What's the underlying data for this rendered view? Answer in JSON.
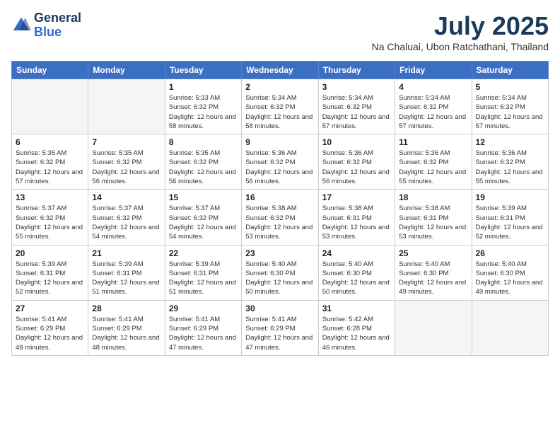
{
  "header": {
    "logo_general": "General",
    "logo_blue": "Blue",
    "month_year": "July 2025",
    "location": "Na Chaluai, Ubon Ratchathani, Thailand"
  },
  "days_of_week": [
    "Sunday",
    "Monday",
    "Tuesday",
    "Wednesday",
    "Thursday",
    "Friday",
    "Saturday"
  ],
  "weeks": [
    [
      {
        "day": "",
        "info": ""
      },
      {
        "day": "",
        "info": ""
      },
      {
        "day": "1",
        "info": "Sunrise: 5:33 AM\nSunset: 6:32 PM\nDaylight: 12 hours and 58 minutes."
      },
      {
        "day": "2",
        "info": "Sunrise: 5:34 AM\nSunset: 6:32 PM\nDaylight: 12 hours and 58 minutes."
      },
      {
        "day": "3",
        "info": "Sunrise: 5:34 AM\nSunset: 6:32 PM\nDaylight: 12 hours and 57 minutes."
      },
      {
        "day": "4",
        "info": "Sunrise: 5:34 AM\nSunset: 6:32 PM\nDaylight: 12 hours and 57 minutes."
      },
      {
        "day": "5",
        "info": "Sunrise: 5:34 AM\nSunset: 6:32 PM\nDaylight: 12 hours and 57 minutes."
      }
    ],
    [
      {
        "day": "6",
        "info": "Sunrise: 5:35 AM\nSunset: 6:32 PM\nDaylight: 12 hours and 57 minutes."
      },
      {
        "day": "7",
        "info": "Sunrise: 5:35 AM\nSunset: 6:32 PM\nDaylight: 12 hours and 56 minutes."
      },
      {
        "day": "8",
        "info": "Sunrise: 5:35 AM\nSunset: 6:32 PM\nDaylight: 12 hours and 56 minutes."
      },
      {
        "day": "9",
        "info": "Sunrise: 5:36 AM\nSunset: 6:32 PM\nDaylight: 12 hours and 56 minutes."
      },
      {
        "day": "10",
        "info": "Sunrise: 5:36 AM\nSunset: 6:32 PM\nDaylight: 12 hours and 56 minutes."
      },
      {
        "day": "11",
        "info": "Sunrise: 5:36 AM\nSunset: 6:32 PM\nDaylight: 12 hours and 55 minutes."
      },
      {
        "day": "12",
        "info": "Sunrise: 5:36 AM\nSunset: 6:32 PM\nDaylight: 12 hours and 55 minutes."
      }
    ],
    [
      {
        "day": "13",
        "info": "Sunrise: 5:37 AM\nSunset: 6:32 PM\nDaylight: 12 hours and 55 minutes."
      },
      {
        "day": "14",
        "info": "Sunrise: 5:37 AM\nSunset: 6:32 PM\nDaylight: 12 hours and 54 minutes."
      },
      {
        "day": "15",
        "info": "Sunrise: 5:37 AM\nSunset: 6:32 PM\nDaylight: 12 hours and 54 minutes."
      },
      {
        "day": "16",
        "info": "Sunrise: 5:38 AM\nSunset: 6:32 PM\nDaylight: 12 hours and 53 minutes."
      },
      {
        "day": "17",
        "info": "Sunrise: 5:38 AM\nSunset: 6:31 PM\nDaylight: 12 hours and 53 minutes."
      },
      {
        "day": "18",
        "info": "Sunrise: 5:38 AM\nSunset: 6:31 PM\nDaylight: 12 hours and 53 minutes."
      },
      {
        "day": "19",
        "info": "Sunrise: 5:39 AM\nSunset: 6:31 PM\nDaylight: 12 hours and 52 minutes."
      }
    ],
    [
      {
        "day": "20",
        "info": "Sunrise: 5:39 AM\nSunset: 6:31 PM\nDaylight: 12 hours and 52 minutes."
      },
      {
        "day": "21",
        "info": "Sunrise: 5:39 AM\nSunset: 6:31 PM\nDaylight: 12 hours and 51 minutes."
      },
      {
        "day": "22",
        "info": "Sunrise: 5:39 AM\nSunset: 6:31 PM\nDaylight: 12 hours and 51 minutes."
      },
      {
        "day": "23",
        "info": "Sunrise: 5:40 AM\nSunset: 6:30 PM\nDaylight: 12 hours and 50 minutes."
      },
      {
        "day": "24",
        "info": "Sunrise: 5:40 AM\nSunset: 6:30 PM\nDaylight: 12 hours and 50 minutes."
      },
      {
        "day": "25",
        "info": "Sunrise: 5:40 AM\nSunset: 6:30 PM\nDaylight: 12 hours and 49 minutes."
      },
      {
        "day": "26",
        "info": "Sunrise: 5:40 AM\nSunset: 6:30 PM\nDaylight: 12 hours and 49 minutes."
      }
    ],
    [
      {
        "day": "27",
        "info": "Sunrise: 5:41 AM\nSunset: 6:29 PM\nDaylight: 12 hours and 48 minutes."
      },
      {
        "day": "28",
        "info": "Sunrise: 5:41 AM\nSunset: 6:29 PM\nDaylight: 12 hours and 48 minutes."
      },
      {
        "day": "29",
        "info": "Sunrise: 5:41 AM\nSunset: 6:29 PM\nDaylight: 12 hours and 47 minutes."
      },
      {
        "day": "30",
        "info": "Sunrise: 5:41 AM\nSunset: 6:29 PM\nDaylight: 12 hours and 47 minutes."
      },
      {
        "day": "31",
        "info": "Sunrise: 5:42 AM\nSunset: 6:28 PM\nDaylight: 12 hours and 46 minutes."
      },
      {
        "day": "",
        "info": ""
      },
      {
        "day": "",
        "info": ""
      }
    ]
  ]
}
